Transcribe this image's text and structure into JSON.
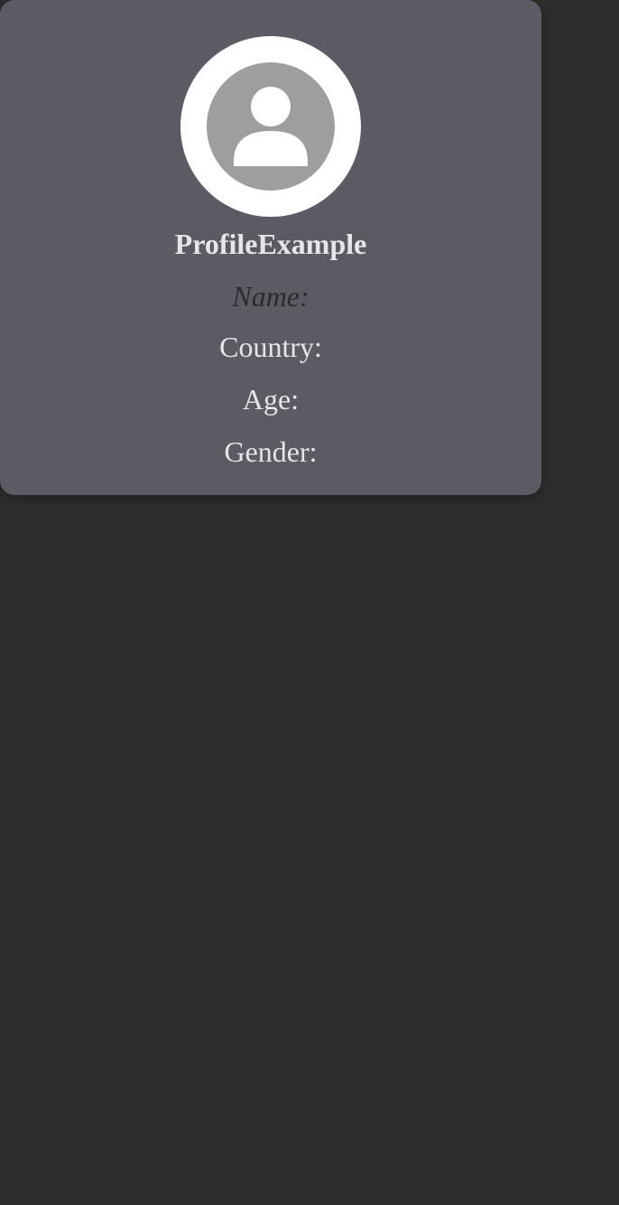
{
  "profile": {
    "title": "ProfileExample",
    "avatar_icon": "user-silhouette-icon",
    "fields": {
      "name_label": "Name:",
      "country_label": "Country:",
      "age_label": "Age:",
      "gender_label": "Gender:"
    }
  },
  "colors": {
    "page_background": "#2d2d2d",
    "card_background": "#5c5b64",
    "avatar_ring": "#ffffff",
    "avatar_fill": "#9e9e9e",
    "text_light": "#e6e6e6",
    "text_dark": "#2b2b2b"
  }
}
